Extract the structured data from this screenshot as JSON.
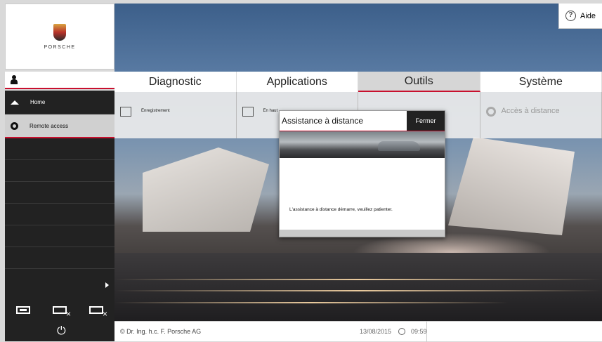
{
  "brand": {
    "wordmark": "PORSCHE"
  },
  "help": {
    "label": "Aide",
    "icon": "help-circle-icon"
  },
  "tabs": [
    {
      "label": "Diagnostic",
      "active": false
    },
    {
      "label": "Applications",
      "active": false
    },
    {
      "label": "Outils",
      "active": true
    },
    {
      "label": "Système",
      "active": false
    }
  ],
  "subtabs": [
    {
      "label": "Enregistrement",
      "icon": "record-icon"
    },
    {
      "label": "En haut",
      "icon": "upload-icon"
    },
    {
      "label": "",
      "icon": ""
    },
    {
      "label": "Accès à distance",
      "icon": "gear-icon",
      "disabled": true
    }
  ],
  "sidebar": {
    "items": [
      {
        "label": "Home",
        "icon": "home-icon"
      },
      {
        "label": "Remote access",
        "icon": "gear-icon",
        "active": true
      }
    ]
  },
  "dialog": {
    "title": "Assistance à distance",
    "close_label": "Fermer",
    "message": "L'assistance à distance démarre, veuillez patienter."
  },
  "footer": {
    "copyright": "© Dr. Ing. h.c. F. Porsche AG",
    "date": "13/08/2015",
    "time": "09:59"
  },
  "colors": {
    "accent": "#c8102e",
    "sidebar_bg": "#222222"
  }
}
